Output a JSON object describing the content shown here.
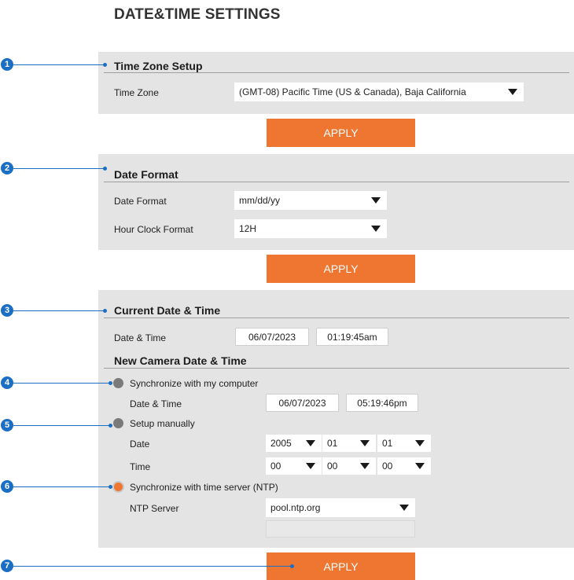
{
  "page": {
    "title": "DATE&TIME SETTINGS"
  },
  "callouts": [
    "1",
    "2",
    "3",
    "4",
    "5",
    "6",
    "7"
  ],
  "time_zone_setup": {
    "title": "Time Zone Setup",
    "time_zone_label": "Time Zone",
    "time_zone_value": "(GMT-08) Pacific Time (US & Canada), Baja California",
    "apply_label": "APPLY"
  },
  "date_format": {
    "title": "Date Format",
    "date_format_label": "Date Format",
    "date_format_value": "mm/dd/yy",
    "hour_clock_label": "Hour Clock Format",
    "hour_clock_value": "12H",
    "apply_label": "APPLY"
  },
  "current_date_time": {
    "title": "Current Date & Time",
    "label": "Date & Time",
    "date": "06/07/2023",
    "time": "01:19:45am"
  },
  "new_date_time": {
    "title": "New Camera Date & Time",
    "sync_computer": {
      "label": "Synchronize with my computer",
      "selected": false,
      "date_time_label": "Date & Time",
      "date": "06/07/2023",
      "time": "05:19:46pm"
    },
    "manual": {
      "label": "Setup manually",
      "selected": false,
      "date_label": "Date",
      "year": "2005",
      "month": "01",
      "day": "01",
      "time_label": "Time",
      "hour": "00",
      "minute": "00",
      "second": "00"
    },
    "ntp": {
      "label": "Synchronize with time server (NTP)",
      "selected": true,
      "server_label": "NTP Server",
      "server_value": "pool.ntp.org"
    },
    "apply_label": "APPLY"
  },
  "colors": {
    "accent": "#ef7631",
    "callout": "#1a6fc4",
    "panel": "#e4e4e4",
    "radio_off": "#7a7a7a"
  }
}
